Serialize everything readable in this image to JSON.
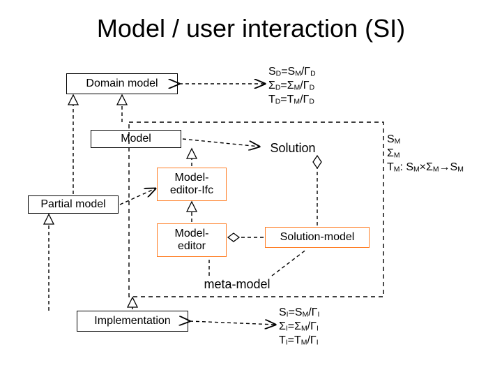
{
  "title": "Model / user interaction (SI)",
  "boxes": {
    "domain_model": "Domain model",
    "model": "Model",
    "solution": "Solution",
    "model_editor_ifc": "Model-\neditor-Ifc",
    "partial_model": "Partial model",
    "model_editor": "Model-\neditor",
    "solution_model": "Solution-model",
    "meta_model": "meta-model",
    "implementation": "Implementation"
  },
  "eq": {
    "top": "S<sub>D</sub>=S<sub>M</sub>/Γ<sub>D</sub><br>Σ<sub>D</sub>=Σ<sub>M</sub>/Γ<sub>D</sub><br>T<sub>D</sub>=T<sub>M</sub>/Γ<sub>D</sub>",
    "right": "S<sub>M</sub><br>Σ<sub>M</sub><br>T<sub>M</sub>: S<sub>M</sub>×Σ<sub>M</sub>→S<sub>M</sub>",
    "bottom": "S<sub>I</sub>=S<sub>M</sub>/Γ<sub>I</sub><br>Σ<sub>I</sub>=Σ<sub>M</sub>/Γ<sub>I</sub><br>T<sub>I</sub>=T<sub>M</sub>/Γ<sub>I</sub>"
  },
  "chart_data": {
    "type": "diagram",
    "nodes": [
      {
        "id": "domain_model",
        "label": "Domain model"
      },
      {
        "id": "model",
        "label": "Model"
      },
      {
        "id": "solution",
        "label": "Solution"
      },
      {
        "id": "model_editor_ifc",
        "label": "Model-editor-Ifc"
      },
      {
        "id": "partial_model",
        "label": "Partial model"
      },
      {
        "id": "model_editor",
        "label": "Model-editor"
      },
      {
        "id": "solution_model",
        "label": "Solution-model"
      },
      {
        "id": "meta_model",
        "label": "meta-model"
      },
      {
        "id": "implementation",
        "label": "Implementation"
      }
    ],
    "edges": [
      {
        "from": "model",
        "to": "domain_model",
        "style": "open-triangle-dashed"
      },
      {
        "from": "partial_model",
        "to": "domain_model",
        "style": "open-triangle-dashed"
      },
      {
        "from": "model_editor_ifc",
        "to": "model",
        "style": "open-triangle-dashed"
      },
      {
        "from": "model_editor",
        "to": "model_editor_ifc",
        "style": "open-triangle-dashed"
      },
      {
        "from": "solution_model",
        "to": "solution",
        "style": "diamond-dashed"
      },
      {
        "from": "solution_model",
        "to": "model_editor",
        "style": "diamond-dashed"
      },
      {
        "from": "meta_model",
        "to": "model_editor",
        "style": "dashed"
      },
      {
        "from": "meta_model",
        "to": "solution_model",
        "style": "dashed"
      },
      {
        "from": "implementation",
        "to": "partial_model",
        "style": "open-triangle-dashed"
      },
      {
        "from": "domain_model",
        "to": "eq_top",
        "style": "arrow-dashed"
      },
      {
        "from": "model",
        "to": "solution",
        "style": "arrow-dashed"
      },
      {
        "from": "implementation",
        "to": "eq_bottom",
        "style": "arrow-dashed"
      }
    ]
  }
}
